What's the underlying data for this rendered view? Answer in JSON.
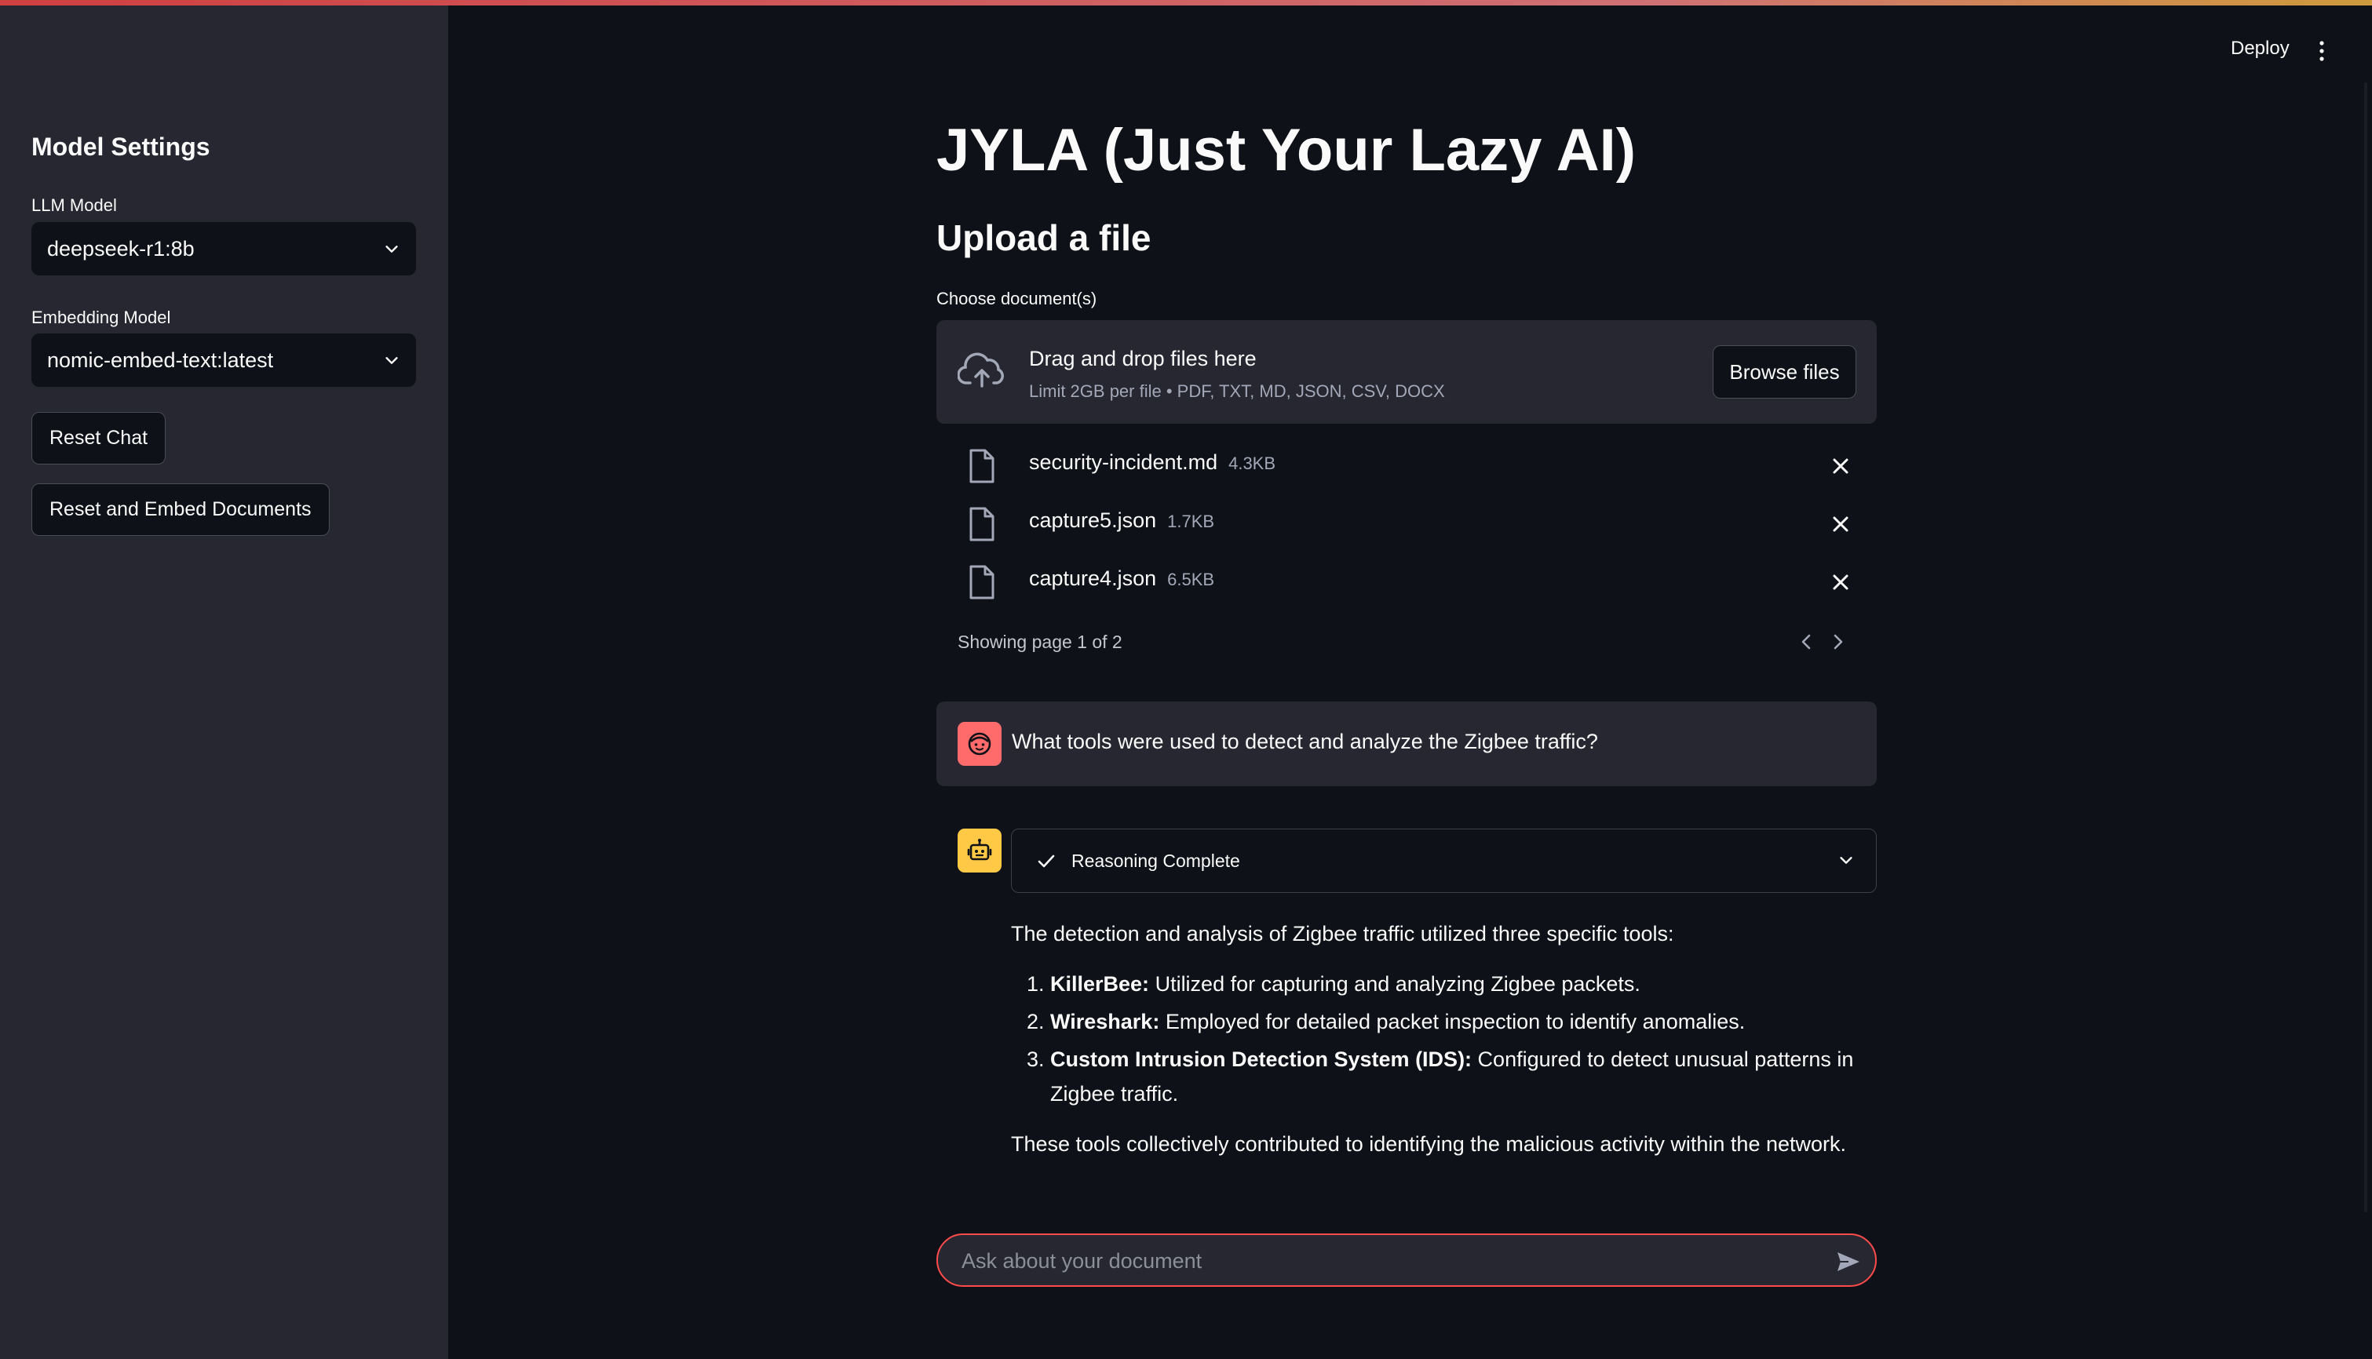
{
  "header": {
    "deploy_label": "Deploy",
    "menu_icon": "kebab-menu-icon"
  },
  "sidebar": {
    "title": "Model Settings",
    "llm_label": "LLM Model",
    "llm_value": "deepseek-r1:8b",
    "embed_label": "Embedding Model",
    "embed_value": "nomic-embed-text:latest",
    "reset_chat_label": "Reset Chat",
    "reset_embed_label": "Reset and Embed Documents"
  },
  "main": {
    "title": "JYLA (Just Your Lazy AI)",
    "subtitle": "Upload a file",
    "uploader": {
      "label": "Choose document(s)",
      "drop_text": "Drag and drop files here",
      "limit_text": "Limit 2GB per file • PDF, TXT, MD, JSON, CSV, DOCX",
      "browse_label": "Browse files",
      "files": [
        {
          "name": "security-incident.md",
          "size": "4.3KB"
        },
        {
          "name": "capture5.json",
          "size": "1.7KB"
        },
        {
          "name": "capture4.json",
          "size": "6.5KB"
        }
      ],
      "page_info": "Showing page 1 of 2"
    },
    "chat": {
      "user_message": "What tools were used to detect and analyze the Zigbee traffic?",
      "reasoning_label": "Reasoning Complete",
      "answer_intro": "The detection and analysis of Zigbee traffic utilized three specific tools:",
      "tools": [
        {
          "name": "KillerBee:",
          "desc": " Utilized for capturing and analyzing Zigbee packets."
        },
        {
          "name": "Wireshark:",
          "desc": " Employed for detailed packet inspection to identify anomalies."
        },
        {
          "name": "Custom Intrusion Detection System (IDS):",
          "desc": " Configured to detect unusual patterns in Zigbee traffic."
        }
      ],
      "answer_outro": "These tools collectively contributed to identifying the malicious activity within the network."
    },
    "input": {
      "placeholder": "Ask about your document"
    }
  },
  "colors": {
    "accent": "#ff4b4b",
    "background": "#0e1117",
    "sidebar": "#262730",
    "bot_avatar": "#ffc845",
    "user_avatar": "#ff6b6b"
  }
}
